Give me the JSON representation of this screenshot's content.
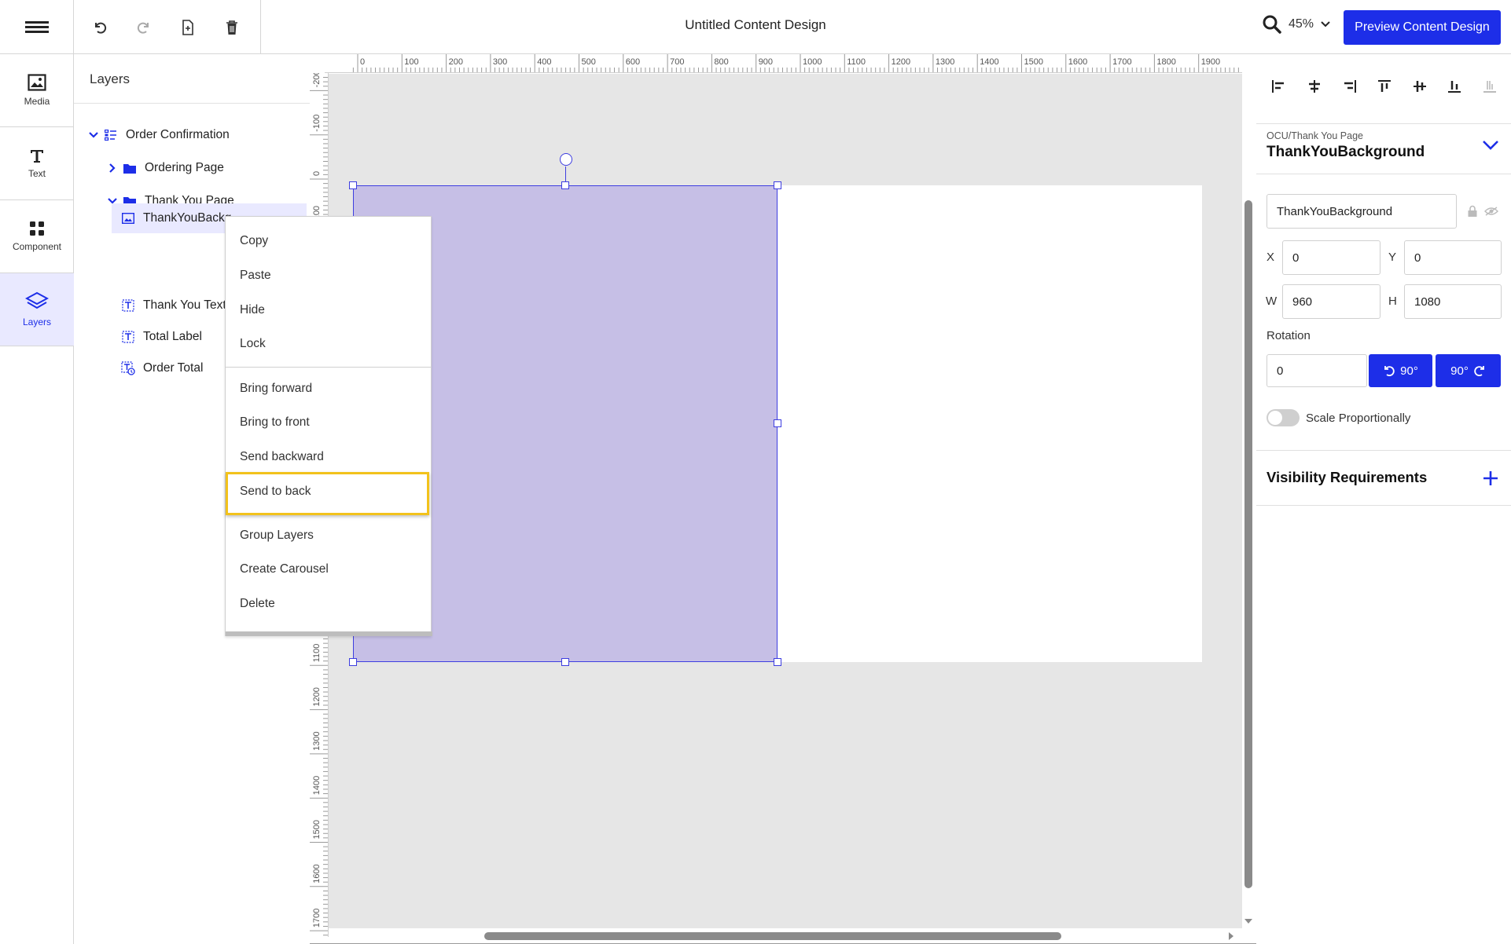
{
  "toolbar": {
    "title": "Untitled Content Design",
    "zoom": "45%",
    "preview_label": "Preview Content Design"
  },
  "rail": {
    "items": [
      {
        "label": "Media",
        "icon": "image-icon"
      },
      {
        "label": "Text",
        "icon": "text-icon"
      },
      {
        "label": "Component",
        "icon": "grid-icon"
      },
      {
        "label": "Layers",
        "icon": "layers-icon"
      }
    ]
  },
  "layers": {
    "title": "Layers",
    "tree": [
      {
        "label": "Order Confirmation"
      },
      {
        "label": "Ordering Page"
      },
      {
        "label": "Thank You Page"
      },
      {
        "label": "ThankYouBackg"
      },
      {
        "label": "Thank You Text"
      },
      {
        "label": "Total Label"
      },
      {
        "label": "Order Total"
      }
    ]
  },
  "rulers": {
    "horizontal": [
      "0",
      "100",
      "200",
      "300",
      "400",
      "500",
      "600",
      "700",
      "800",
      "900",
      "1000",
      "1100",
      "1200",
      "1300",
      "1400",
      "1500",
      "1600",
      "1700",
      "1800",
      "1900",
      "200"
    ],
    "vertical": [
      "-200",
      "-100",
      "0",
      "100",
      "1100",
      "1200",
      "1300",
      "1400",
      "1500",
      "1600",
      "1700"
    ]
  },
  "context_menu": {
    "items": [
      "Copy",
      "Paste",
      "Hide",
      "Lock",
      "Bring forward",
      "Bring to front",
      "Send backward",
      "Send to back",
      "Group Layers",
      "Create Carousel",
      "Delete"
    ],
    "highlight_color": "#f2c21b"
  },
  "properties": {
    "breadcrumb": "OCU/Thank You Page",
    "layer_name": "ThankYouBackground",
    "name_value": "ThankYouBackground",
    "x_label": "X",
    "x_value": "0",
    "y_label": "Y",
    "y_value": "0",
    "w_label": "W",
    "w_value": "960",
    "h_label": "H",
    "h_value": "1080",
    "rotation_label": "Rotation",
    "rotation_value": "0",
    "rotate_ccw_label": "90°",
    "rotate_cw_label": "90°",
    "scale_label": "Scale Proportionally",
    "visibility_title": "Visibility Requirements"
  },
  "colors": {
    "accent": "#1d2ee8",
    "selection_fill": "#c6bfe6",
    "canvas_bg": "#e6e6e6"
  }
}
